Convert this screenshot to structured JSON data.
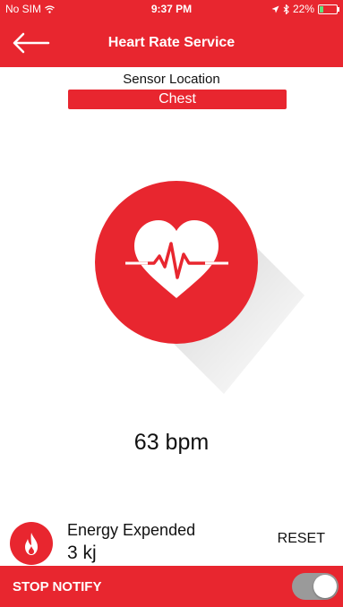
{
  "status_bar": {
    "carrier": "No SIM",
    "time": "9:37 PM",
    "battery": "22%",
    "battery_level": 0.22
  },
  "nav": {
    "title": "Heart Rate Service",
    "back_icon": "arrow-left-icon"
  },
  "sensor": {
    "label": "Sensor Location",
    "value": "Chest"
  },
  "heart_rate": {
    "display": "63 bpm",
    "icon": "heart-pulse-icon"
  },
  "energy": {
    "label": "Energy Expended",
    "value": "3 kj",
    "icon": "flame-icon",
    "reset_label": "RESET"
  },
  "bottom": {
    "label": "STOP NOTIFY",
    "toggle_on": true
  },
  "colors": {
    "accent": "#e8262f",
    "toggle_track": "#9a9a9a"
  }
}
